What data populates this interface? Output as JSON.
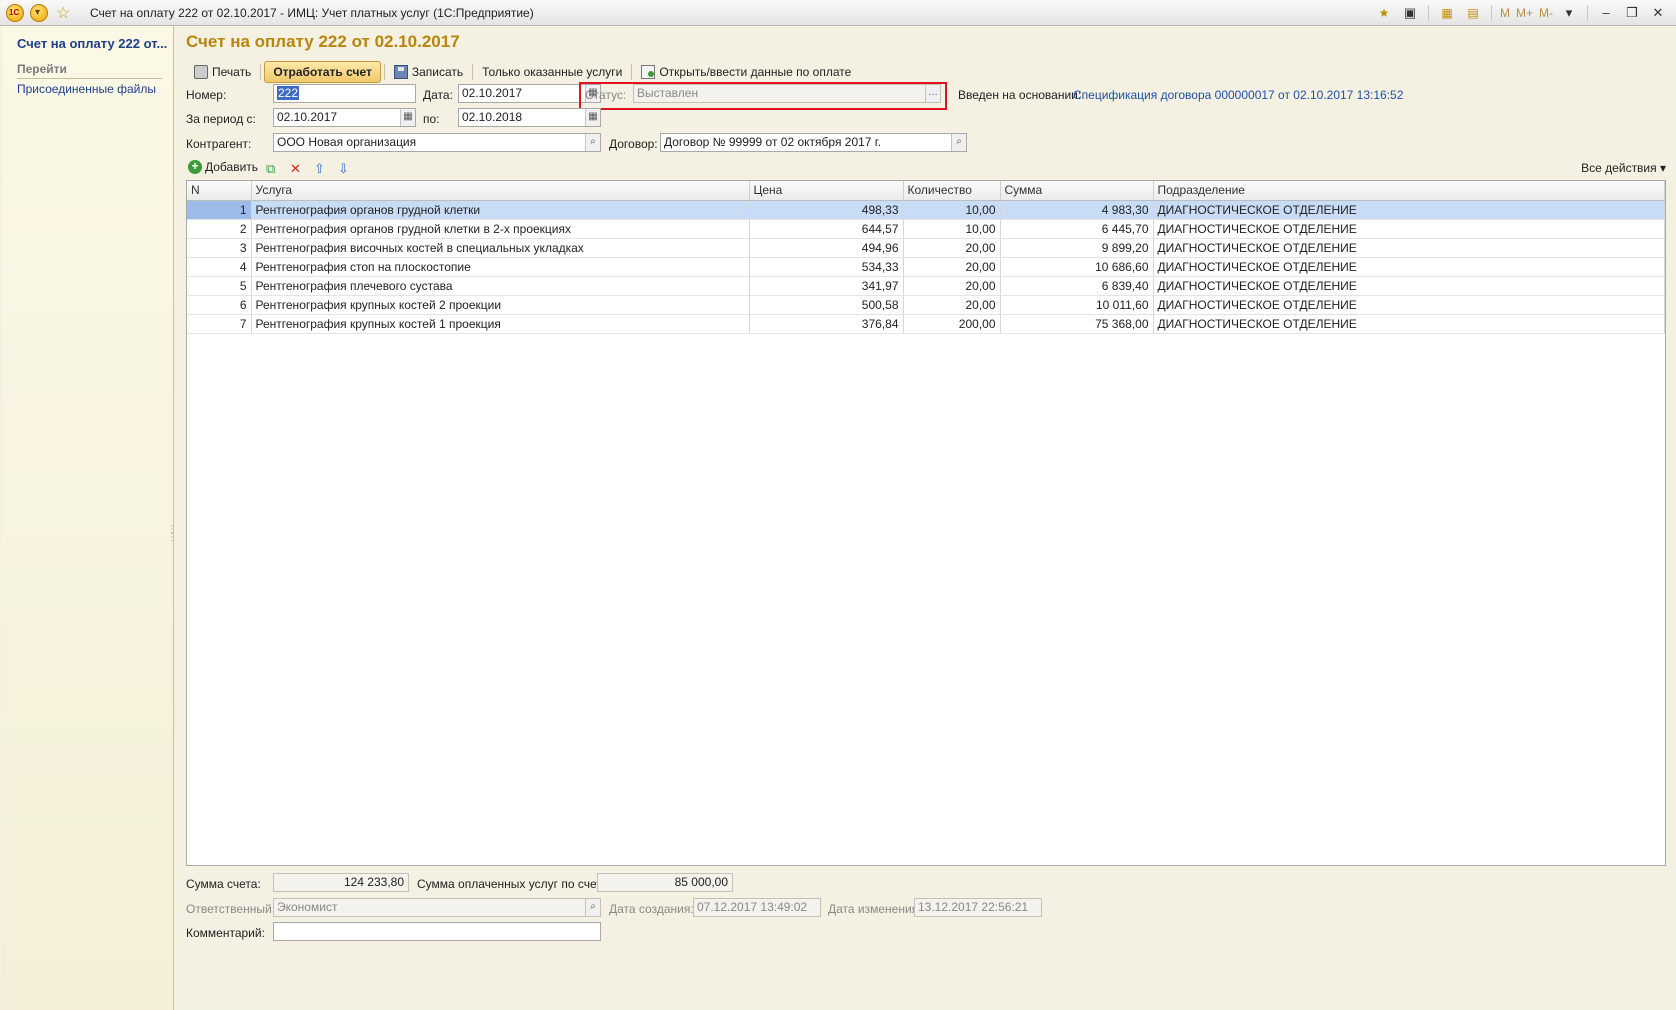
{
  "window": {
    "title": "Счет на оплату 222 от 02.10.2017 - ИМЦ: Учет платных услуг  (1С:Предприятие)",
    "logo_text": "1С",
    "m_buttons": [
      "M",
      "M+",
      "M-"
    ]
  },
  "sidebar": {
    "title": "Счет на оплату 222 от...",
    "goto_label": "Перейти",
    "items": [
      {
        "label": "Присоединенные файлы"
      }
    ]
  },
  "document": {
    "title": "Счет на оплату 222 от 02.10.2017"
  },
  "toolbar": {
    "print_label": "Печать",
    "process_label": "Отработать счет",
    "save_label": "Записать",
    "only_rendered_label": "Только оказанные услуги",
    "open_payment_label": "Открыть/ввести данные по оплате"
  },
  "form": {
    "number_label": "Номер:",
    "number_value": "222",
    "date_label": "Дата:",
    "date_value": "02.10.2017",
    "status_label": "Статус:",
    "status_value": "Выставлен",
    "basis_label": "Введен на основании:",
    "basis_link": "Спецификация договора 000000017 от 02.10.2017 13:16:52",
    "period_from_label": "За период с:",
    "period_from_value": "02.10.2017",
    "period_to_label": "по:",
    "period_to_value": "02.10.2018",
    "counterparty_label": "Контрагент:",
    "counterparty_value": "ООО Новая организация",
    "contract_label": "Договор:",
    "contract_value": "Договор № 99999 от 02 октября 2017 г."
  },
  "table_toolbar": {
    "add_label": "Добавить",
    "all_actions_label": "Все действия"
  },
  "table": {
    "columns": [
      "N",
      "Услуга",
      "Цена",
      "Количество",
      "Сумма",
      "Подразделение"
    ],
    "rows": [
      {
        "n": "1",
        "service": "Рентгенография органов грудной клетки",
        "price": "498,33",
        "qty": "10,00",
        "sum": "4 983,30",
        "dept": "ДИАГНОСТИЧЕСКОЕ ОТДЕЛЕНИЕ"
      },
      {
        "n": "2",
        "service": "Рентгенография органов грудной клетки в 2-х проекциях",
        "price": "644,57",
        "qty": "10,00",
        "sum": "6 445,70",
        "dept": "ДИАГНОСТИЧЕСКОЕ ОТДЕЛЕНИЕ"
      },
      {
        "n": "3",
        "service": "Рентгенография височных костей в специальных укладках",
        "price": "494,96",
        "qty": "20,00",
        "sum": "9 899,20",
        "dept": "ДИАГНОСТИЧЕСКОЕ ОТДЕЛЕНИЕ"
      },
      {
        "n": "4",
        "service": "Рентгенография стоп на плоскостопие",
        "price": "534,33",
        "qty": "20,00",
        "sum": "10 686,60",
        "dept": "ДИАГНОСТИЧЕСКОЕ ОТДЕЛЕНИЕ"
      },
      {
        "n": "5",
        "service": "Рентгенография плечевого сустава",
        "price": "341,97",
        "qty": "20,00",
        "sum": "6 839,40",
        "dept": "ДИАГНОСТИЧЕСКОЕ ОТДЕЛЕНИЕ"
      },
      {
        "n": "6",
        "service": "Рентгенография крупных костей 2 проекции",
        "price": "500,58",
        "qty": "20,00",
        "sum": "10 011,60",
        "dept": "ДИАГНОСТИЧЕСКОЕ ОТДЕЛЕНИЕ"
      },
      {
        "n": "7",
        "service": "Рентгенография крупных костей 1 проекция",
        "price": "376,84",
        "qty": "200,00",
        "sum": "75 368,00",
        "dept": "ДИАГНОСТИЧЕСКОЕ ОТДЕЛЕНИЕ"
      }
    ]
  },
  "footer": {
    "total_label": "Сумма счета:",
    "total_value": "124 233,80",
    "paid_label": "Сумма оплаченных услуг по счету:",
    "paid_value": "85 000,00",
    "responsible_label": "Ответственный:",
    "responsible_value": "Экономист",
    "created_label": "Дата создания:",
    "created_value": "07.12.2017 13:49:02",
    "modified_label": "Дата изменения:",
    "modified_value": "13.12.2017 22:56:21",
    "comment_label": "Комментарий:",
    "comment_value": ""
  },
  "colors": {
    "title_gold": "#b8860b",
    "link_blue": "#1e4fa8",
    "highlight_red": "#e0141e",
    "selected_row": "#c9dcf5"
  }
}
